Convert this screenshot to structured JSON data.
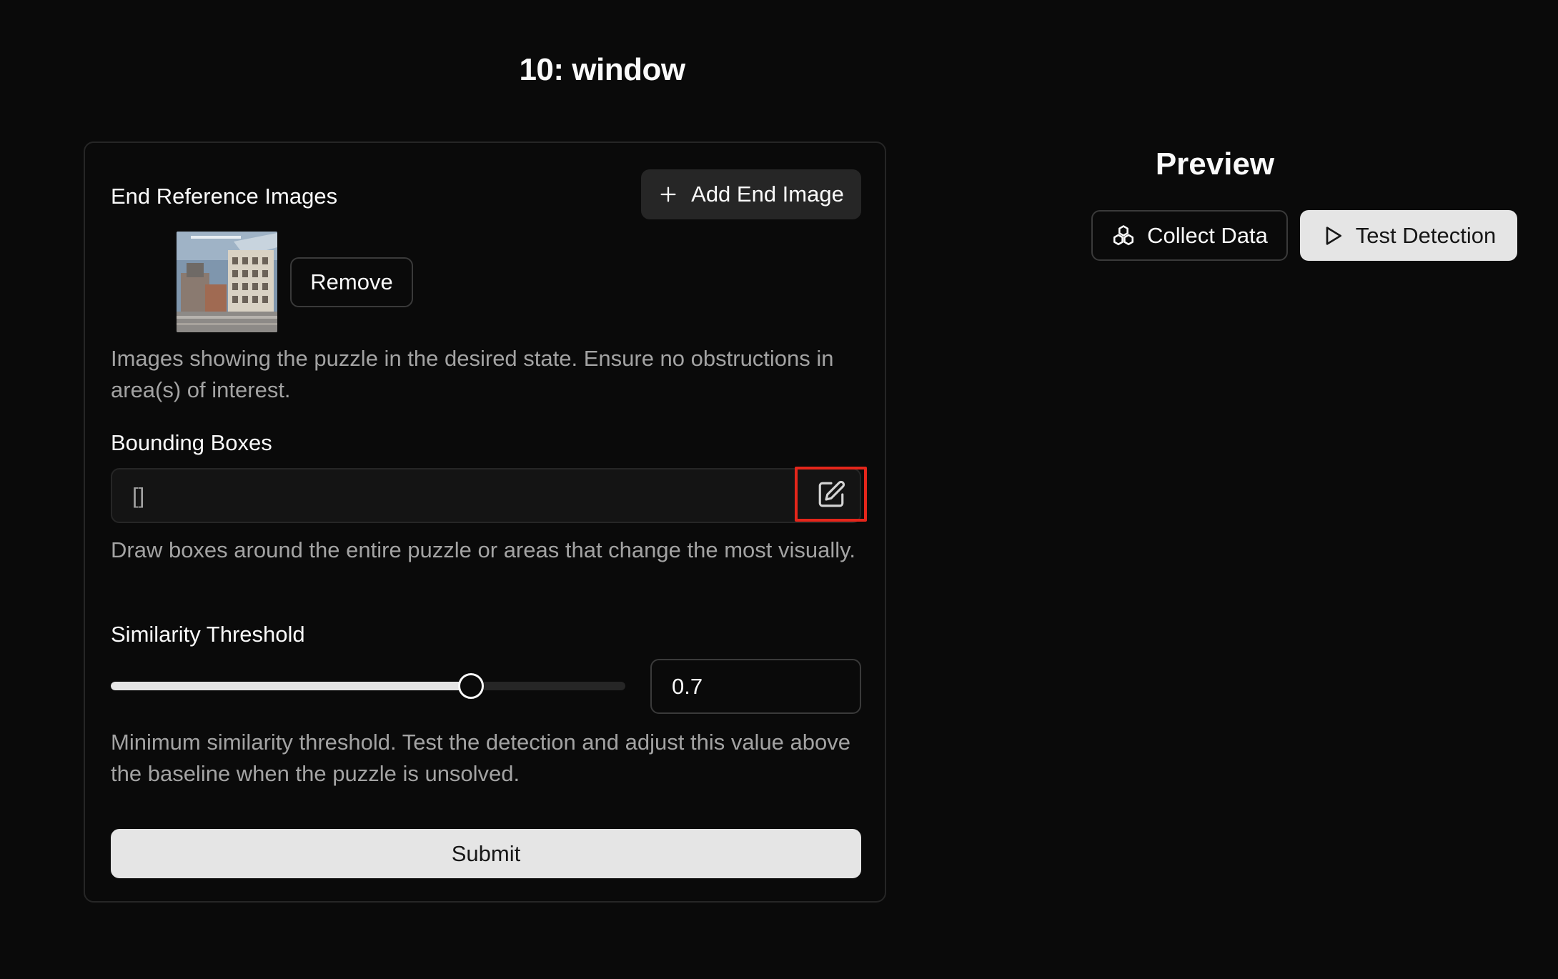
{
  "page": {
    "title": "10: window"
  },
  "form": {
    "end_images": {
      "label": "End Reference Images",
      "add_button_label": "Add End Image",
      "remove_button_label": "Remove",
      "help": "Images showing the puzzle in the desired state. Ensure no obstructions in area(s) of interest."
    },
    "bounding_boxes": {
      "label": "Bounding Boxes",
      "value": "[]",
      "help": "Draw boxes around the entire puzzle or areas that change the most visually."
    },
    "similarity": {
      "label": "Similarity Threshold",
      "value": "0.7",
      "slider_fraction": 0.7,
      "help": "Minimum similarity threshold. Test the detection and adjust this value above the baseline when the puzzle is unsolved."
    },
    "submit_label": "Submit"
  },
  "preview": {
    "title": "Preview",
    "collect_label": "Collect Data",
    "test_label": "Test Detection"
  },
  "icons": {
    "add": "plus-icon",
    "edit": "edit-icon",
    "collect": "boxes-icon",
    "test": "play-icon"
  },
  "colors": {
    "background": "#0a0a0a",
    "highlight": "#e5261b",
    "primary_button": "#e5e5e5"
  }
}
